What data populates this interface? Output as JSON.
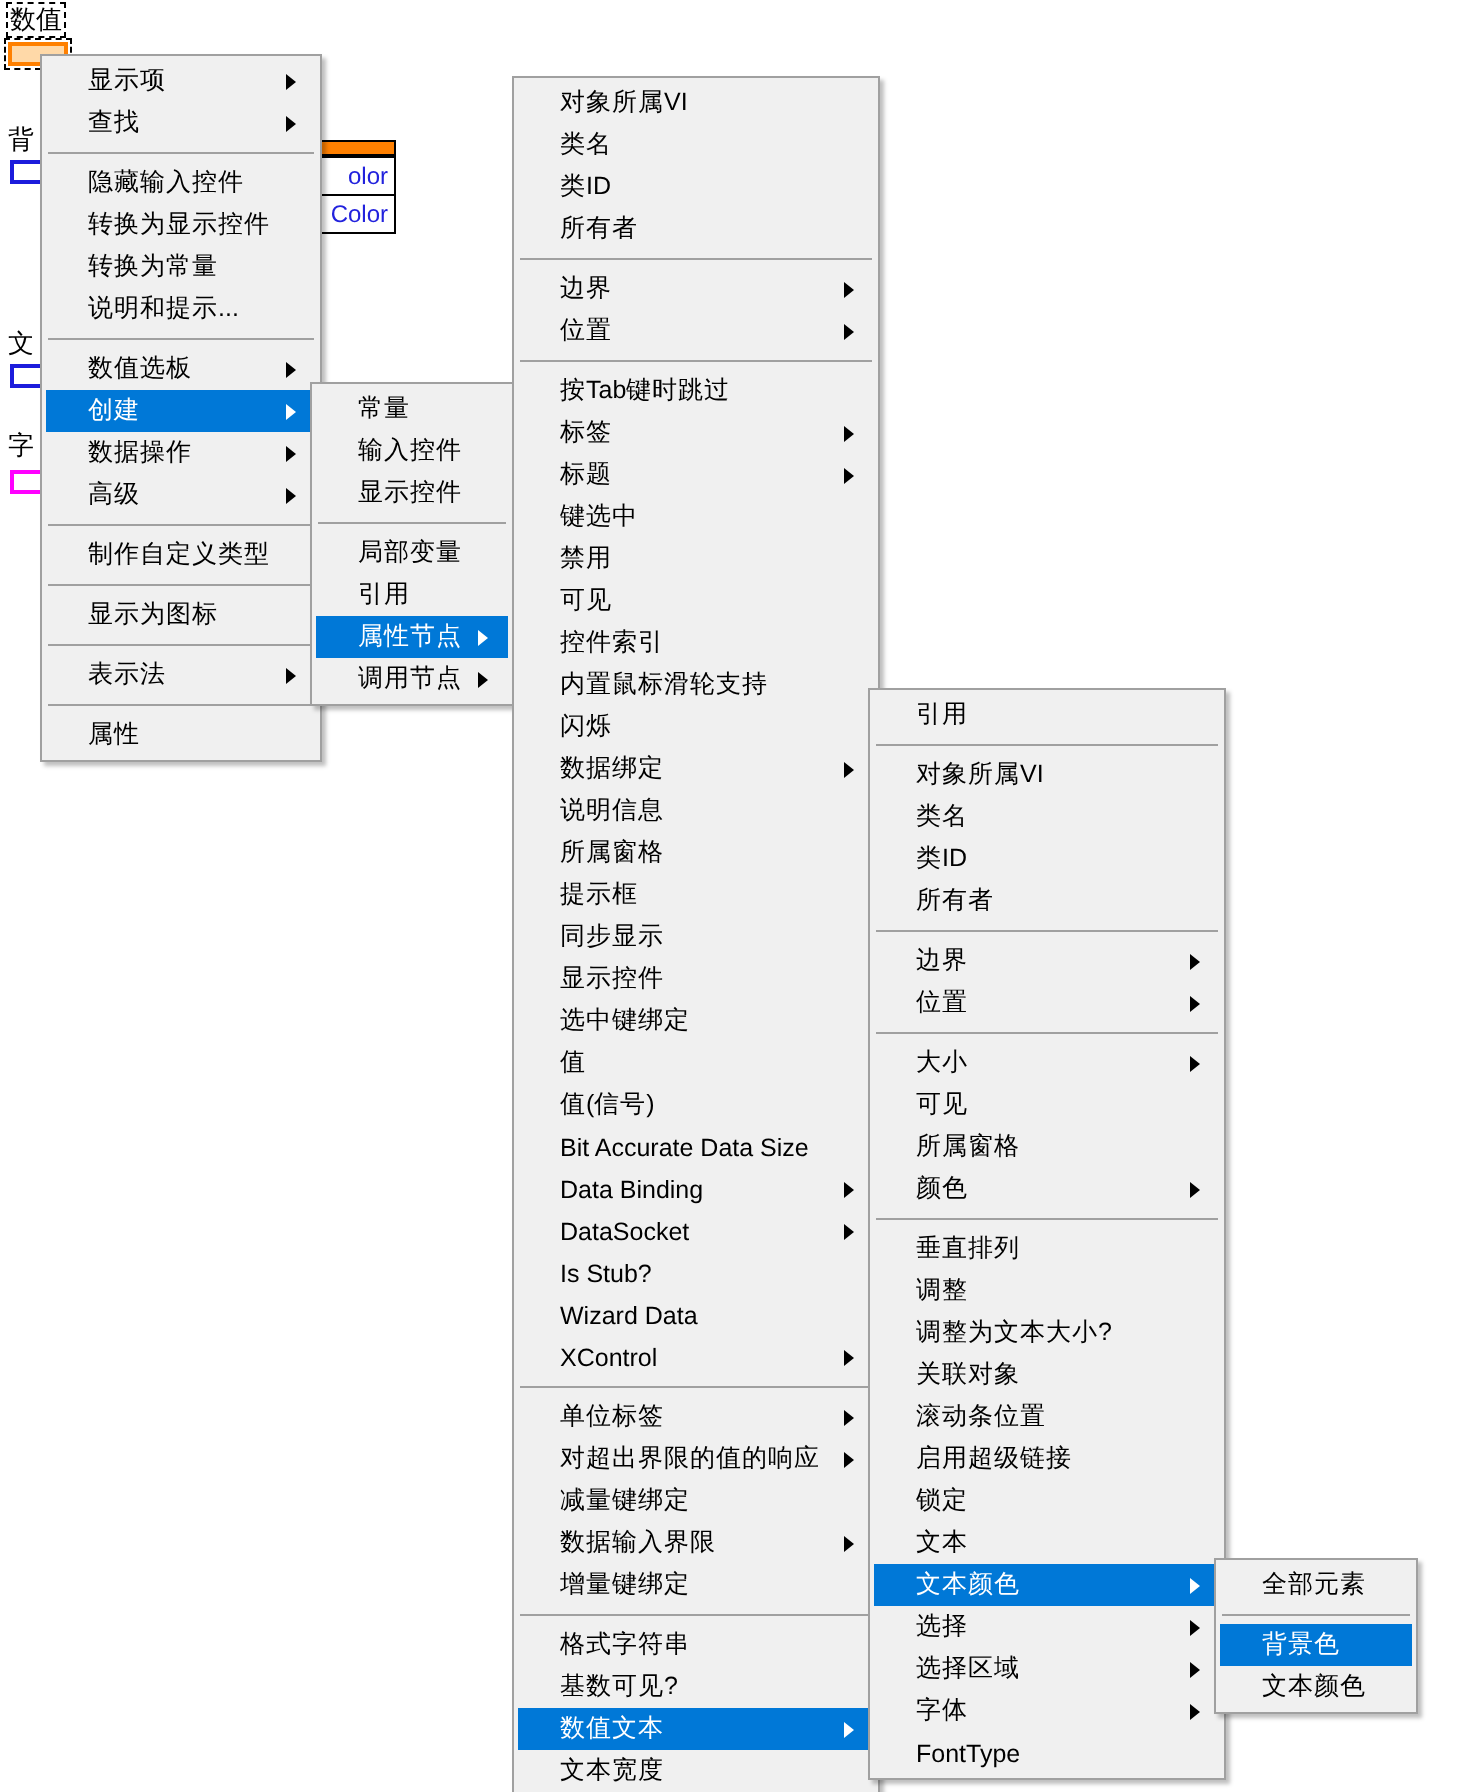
{
  "canvas": {
    "labels": [
      {
        "text": "数值",
        "kind": "selected-label"
      },
      {
        "text": "背",
        "kind": "label"
      },
      {
        "text": "文",
        "kind": "label"
      },
      {
        "text": "字",
        "kind": "label"
      }
    ],
    "property_node": {
      "rows": [
        "olor",
        "Color"
      ]
    }
  },
  "menus": [
    {
      "items": [
        {
          "kind": "item",
          "label": "显示项",
          "submenu": true,
          "selected": false
        },
        {
          "kind": "item",
          "label": "查找",
          "submenu": true,
          "selected": false
        },
        {
          "kind": "separator"
        },
        {
          "kind": "item",
          "label": "隐藏输入控件",
          "submenu": false,
          "selected": false
        },
        {
          "kind": "item",
          "label": "转换为显示控件",
          "submenu": false,
          "selected": false
        },
        {
          "kind": "item",
          "label": "转换为常量",
          "submenu": false,
          "selected": false
        },
        {
          "kind": "item",
          "label": "说明和提示...",
          "submenu": false,
          "selected": false
        },
        {
          "kind": "separator"
        },
        {
          "kind": "item",
          "label": "数值选板",
          "submenu": true,
          "selected": false
        },
        {
          "kind": "item",
          "label": "创建",
          "submenu": true,
          "selected": true
        },
        {
          "kind": "item",
          "label": "数据操作",
          "submenu": true,
          "selected": false
        },
        {
          "kind": "item",
          "label": "高级",
          "submenu": true,
          "selected": false
        },
        {
          "kind": "separator"
        },
        {
          "kind": "item",
          "label": "制作自定义类型",
          "submenu": false,
          "selected": false
        },
        {
          "kind": "separator"
        },
        {
          "kind": "item",
          "label": "显示为图标",
          "submenu": false,
          "selected": false
        },
        {
          "kind": "separator"
        },
        {
          "kind": "item",
          "label": "表示法",
          "submenu": true,
          "selected": false
        },
        {
          "kind": "separator"
        },
        {
          "kind": "item",
          "label": "属性",
          "submenu": false,
          "selected": false
        }
      ]
    },
    {
      "items": [
        {
          "kind": "item",
          "label": "常量",
          "submenu": false,
          "selected": false
        },
        {
          "kind": "item",
          "label": "输入控件",
          "submenu": false,
          "selected": false
        },
        {
          "kind": "item",
          "label": "显示控件",
          "submenu": false,
          "selected": false
        },
        {
          "kind": "separator"
        },
        {
          "kind": "item",
          "label": "局部变量",
          "submenu": false,
          "selected": false
        },
        {
          "kind": "item",
          "label": "引用",
          "submenu": false,
          "selected": false
        },
        {
          "kind": "item",
          "label": "属性节点",
          "submenu": true,
          "selected": true
        },
        {
          "kind": "item",
          "label": "调用节点",
          "submenu": true,
          "selected": false
        }
      ]
    },
    {
      "items": [
        {
          "kind": "item",
          "label": "对象所属VI",
          "submenu": false,
          "selected": false
        },
        {
          "kind": "item",
          "label": "类名",
          "submenu": false,
          "selected": false
        },
        {
          "kind": "item",
          "label": "类ID",
          "submenu": false,
          "selected": false
        },
        {
          "kind": "item",
          "label": "所有者",
          "submenu": false,
          "selected": false
        },
        {
          "kind": "separator"
        },
        {
          "kind": "item",
          "label": "边界",
          "submenu": true,
          "selected": false
        },
        {
          "kind": "item",
          "label": "位置",
          "submenu": true,
          "selected": false
        },
        {
          "kind": "separator"
        },
        {
          "kind": "item",
          "label": "按Tab键时跳过",
          "submenu": false,
          "selected": false
        },
        {
          "kind": "item",
          "label": "标签",
          "submenu": true,
          "selected": false
        },
        {
          "kind": "item",
          "label": "标题",
          "submenu": true,
          "selected": false
        },
        {
          "kind": "item",
          "label": "键选中",
          "submenu": false,
          "selected": false
        },
        {
          "kind": "item",
          "label": "禁用",
          "submenu": false,
          "selected": false
        },
        {
          "kind": "item",
          "label": "可见",
          "submenu": false,
          "selected": false
        },
        {
          "kind": "item",
          "label": "控件索引",
          "submenu": false,
          "selected": false
        },
        {
          "kind": "item",
          "label": "内置鼠标滑轮支持",
          "submenu": false,
          "selected": false
        },
        {
          "kind": "item",
          "label": "闪烁",
          "submenu": false,
          "selected": false
        },
        {
          "kind": "item",
          "label": "数据绑定",
          "submenu": true,
          "selected": false
        },
        {
          "kind": "item",
          "label": "说明信息",
          "submenu": false,
          "selected": false
        },
        {
          "kind": "item",
          "label": "所属窗格",
          "submenu": false,
          "selected": false
        },
        {
          "kind": "item",
          "label": "提示框",
          "submenu": false,
          "selected": false
        },
        {
          "kind": "item",
          "label": "同步显示",
          "submenu": false,
          "selected": false
        },
        {
          "kind": "item",
          "label": "显示控件",
          "submenu": false,
          "selected": false
        },
        {
          "kind": "item",
          "label": "选中键绑定",
          "submenu": false,
          "selected": false
        },
        {
          "kind": "item",
          "label": "值",
          "submenu": false,
          "selected": false
        },
        {
          "kind": "item",
          "label": "值(信号)",
          "submenu": false,
          "selected": false
        },
        {
          "kind": "item",
          "label": "Bit Accurate Data Size",
          "submenu": false,
          "selected": false
        },
        {
          "kind": "item",
          "label": "Data Binding",
          "submenu": true,
          "selected": false
        },
        {
          "kind": "item",
          "label": "DataSocket",
          "submenu": true,
          "selected": false
        },
        {
          "kind": "item",
          "label": "Is Stub?",
          "submenu": false,
          "selected": false
        },
        {
          "kind": "item",
          "label": "Wizard Data",
          "submenu": false,
          "selected": false
        },
        {
          "kind": "item",
          "label": "XControl",
          "submenu": true,
          "selected": false
        },
        {
          "kind": "separator"
        },
        {
          "kind": "item",
          "label": "单位标签",
          "submenu": true,
          "selected": false
        },
        {
          "kind": "item",
          "label": "对超出界限的值的响应",
          "submenu": true,
          "selected": false
        },
        {
          "kind": "item",
          "label": "减量键绑定",
          "submenu": false,
          "selected": false
        },
        {
          "kind": "item",
          "label": "数据输入界限",
          "submenu": true,
          "selected": false
        },
        {
          "kind": "item",
          "label": "增量键绑定",
          "submenu": false,
          "selected": false
        },
        {
          "kind": "separator"
        },
        {
          "kind": "item",
          "label": "格式字符串",
          "submenu": false,
          "selected": false
        },
        {
          "kind": "item",
          "label": "基数可见?",
          "submenu": false,
          "selected": false
        },
        {
          "kind": "item",
          "label": "数值文本",
          "submenu": true,
          "selected": true
        },
        {
          "kind": "item",
          "label": "文本宽度",
          "submenu": false,
          "selected": false
        }
      ]
    },
    {
      "items": [
        {
          "kind": "item",
          "label": "引用",
          "submenu": false,
          "selected": false
        },
        {
          "kind": "separator"
        },
        {
          "kind": "item",
          "label": "对象所属VI",
          "submenu": false,
          "selected": false
        },
        {
          "kind": "item",
          "label": "类名",
          "submenu": false,
          "selected": false
        },
        {
          "kind": "item",
          "label": "类ID",
          "submenu": false,
          "selected": false
        },
        {
          "kind": "item",
          "label": "所有者",
          "submenu": false,
          "selected": false
        },
        {
          "kind": "separator"
        },
        {
          "kind": "item",
          "label": "边界",
          "submenu": true,
          "selected": false
        },
        {
          "kind": "item",
          "label": "位置",
          "submenu": true,
          "selected": false
        },
        {
          "kind": "separator"
        },
        {
          "kind": "item",
          "label": "大小",
          "submenu": true,
          "selected": false
        },
        {
          "kind": "item",
          "label": "可见",
          "submenu": false,
          "selected": false
        },
        {
          "kind": "item",
          "label": "所属窗格",
          "submenu": false,
          "selected": false
        },
        {
          "kind": "item",
          "label": "颜色",
          "submenu": true,
          "selected": false
        },
        {
          "kind": "separator"
        },
        {
          "kind": "item",
          "label": "垂直排列",
          "submenu": false,
          "selected": false
        },
        {
          "kind": "item",
          "label": "调整",
          "submenu": false,
          "selected": false
        },
        {
          "kind": "item",
          "label": "调整为文本大小?",
          "submenu": false,
          "selected": false
        },
        {
          "kind": "item",
          "label": "关联对象",
          "submenu": false,
          "selected": false
        },
        {
          "kind": "item",
          "label": "滚动条位置",
          "submenu": false,
          "selected": false
        },
        {
          "kind": "item",
          "label": "启用超级链接",
          "submenu": false,
          "selected": false
        },
        {
          "kind": "item",
          "label": "锁定",
          "submenu": false,
          "selected": false
        },
        {
          "kind": "item",
          "label": "文本",
          "submenu": false,
          "selected": false
        },
        {
          "kind": "item",
          "label": "文本颜色",
          "submenu": true,
          "selected": true
        },
        {
          "kind": "item",
          "label": "选择",
          "submenu": true,
          "selected": false
        },
        {
          "kind": "item",
          "label": "选择区域",
          "submenu": true,
          "selected": false
        },
        {
          "kind": "item",
          "label": "字体",
          "submenu": true,
          "selected": false
        },
        {
          "kind": "item",
          "label": "FontType",
          "submenu": false,
          "selected": false
        }
      ]
    },
    {
      "items": [
        {
          "kind": "item",
          "label": "全部元素",
          "submenu": false,
          "selected": false
        },
        {
          "kind": "separator"
        },
        {
          "kind": "item",
          "label": "背景色",
          "submenu": false,
          "selected": true
        },
        {
          "kind": "item",
          "label": "文本颜色",
          "submenu": false,
          "selected": false
        }
      ]
    }
  ]
}
